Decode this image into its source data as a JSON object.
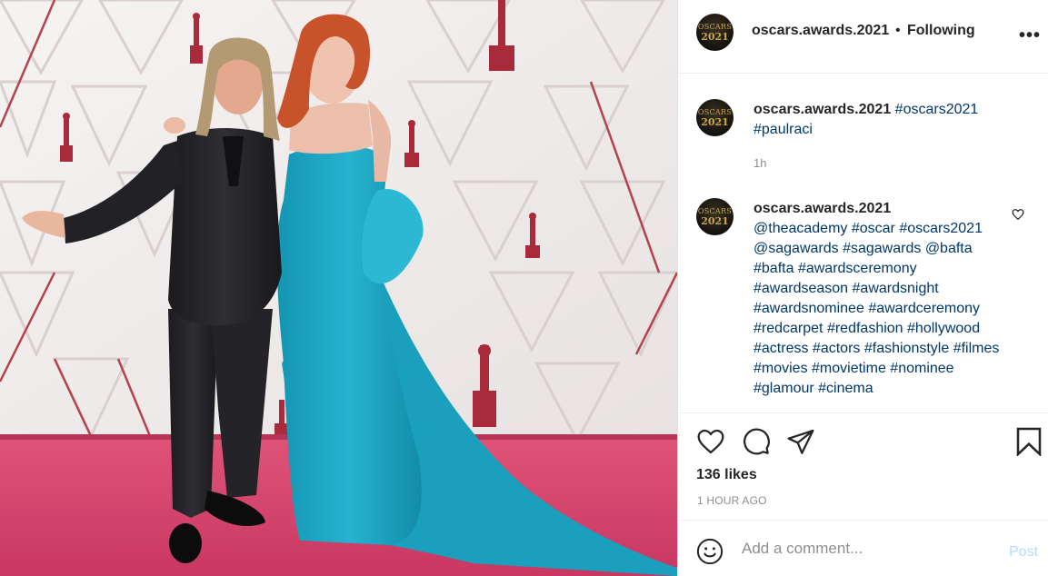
{
  "header": {
    "avatar_text_top": "OSCARS",
    "avatar_text_bottom": "2021",
    "username": "oscars.awards.2021",
    "dot": "•",
    "follow_status": "Following",
    "more_icon": "more-horizontal-icon",
    "more_label": "•••"
  },
  "comments": [
    {
      "username": "oscars.awards.2021",
      "text_tokens": [
        "#oscars2021",
        "#paulraci"
      ],
      "time": "1h"
    },
    {
      "username": "oscars.awards.2021",
      "text_tokens": [
        "@theacademy",
        "#oscar",
        "#oscars2021",
        "@sagawards",
        "#sagawards",
        "@bafta",
        "#bafta",
        "#awardsceremony",
        "#awardseason",
        "#awardsnight",
        "#awardsnominee",
        "#awardceremony",
        "#redcarpet",
        "#redfashion",
        "#hollywood",
        "#actress",
        "#actors",
        "#fashionstyle",
        "#filmes",
        "#movies",
        "#movietime",
        "#nominee",
        "#glamour",
        "#cinema"
      ],
      "like_icon": "heart-outline-icon"
    }
  ],
  "actions": {
    "like_icon": "heart-outline-icon",
    "comment_icon": "speech-bubble-icon",
    "share_icon": "paper-plane-icon",
    "save_icon": "bookmark-icon",
    "likes_text": "136 likes",
    "post_time": "1 HOUR AGO"
  },
  "add_comment": {
    "emoji_icon": "smiley-icon",
    "placeholder": "Add a comment...",
    "post_label": "Post"
  },
  "colors": {
    "hashtag": "#00376b",
    "post_button_disabled": "#b3dbff",
    "secondary_text": "#8e8e8e",
    "carpet": "#d7426a",
    "dress": "#1fa5c0"
  }
}
